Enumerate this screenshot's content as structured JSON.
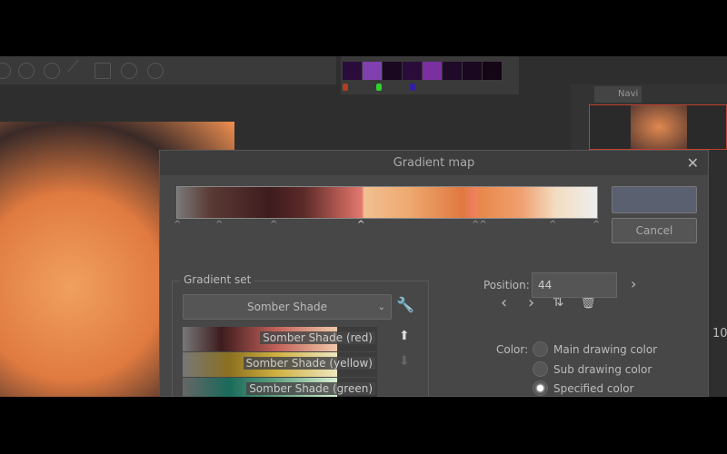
{
  "dialog": {
    "title": "Gradient map",
    "ok_label": "",
    "cancel_label": "Cancel",
    "gradient_set_label": "Gradient set",
    "selected_set": "Somber Shade",
    "gradients": [
      "Somber Shade (red)",
      "Somber Shade (yellow)",
      "Somber Shade (green)"
    ],
    "position_label": "Position:",
    "position_value": "44",
    "color_label": "Color:",
    "color_options": [
      "Main drawing color",
      "Sub drawing color",
      "Specified color"
    ],
    "selected_color_option": 2
  },
  "nav": {
    "tab_label": "Navi"
  },
  "side": {
    "value": "10"
  }
}
